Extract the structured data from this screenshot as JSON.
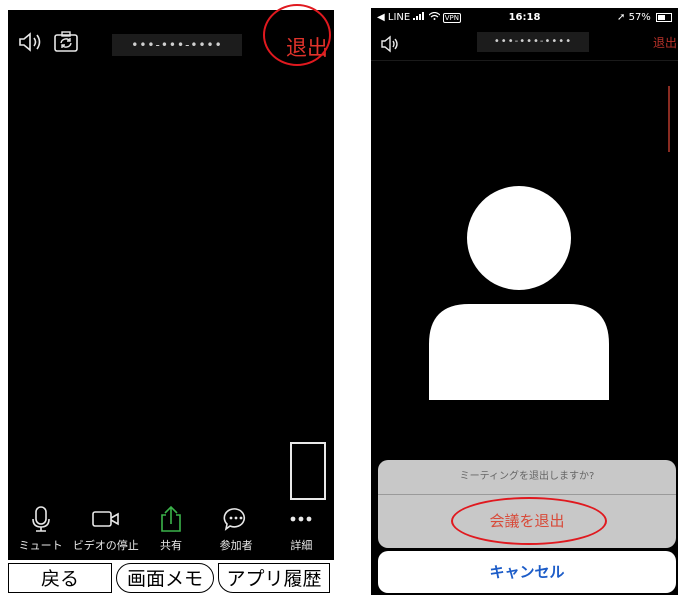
{
  "left_screen": {
    "meeting_id": "•••-•••-••••",
    "leave_label": "退出",
    "toolbar": [
      {
        "label": "ミュート",
        "icon": "microphone-icon"
      },
      {
        "label": "ビデオの停止",
        "icon": "video-camera-icon"
      },
      {
        "label": "共有",
        "icon": "share-icon"
      },
      {
        "label": "参加者",
        "icon": "chat-bubble-icon"
      },
      {
        "label": "詳細",
        "icon": "more-dots-icon"
      }
    ],
    "bottom_buttons": {
      "back": "戻る",
      "memo": "画面メモ",
      "history": "アプリ履歴"
    }
  },
  "right_screen": {
    "status_bar": {
      "carrier": "◀ LINE",
      "vpn": "VPN",
      "time": "16:18",
      "battery": "57%"
    },
    "meeting_id": "•••-•••-••••",
    "leave_label": "退出",
    "sheet": {
      "message": "ミーティングを退出しますか?",
      "exit_label": "会議を退出",
      "cancel_label": "キャンセル"
    }
  },
  "colors": {
    "accent_red": "#e0332b",
    "cancel_blue": "#1c5cc8",
    "share_green": "#3bb34a"
  }
}
